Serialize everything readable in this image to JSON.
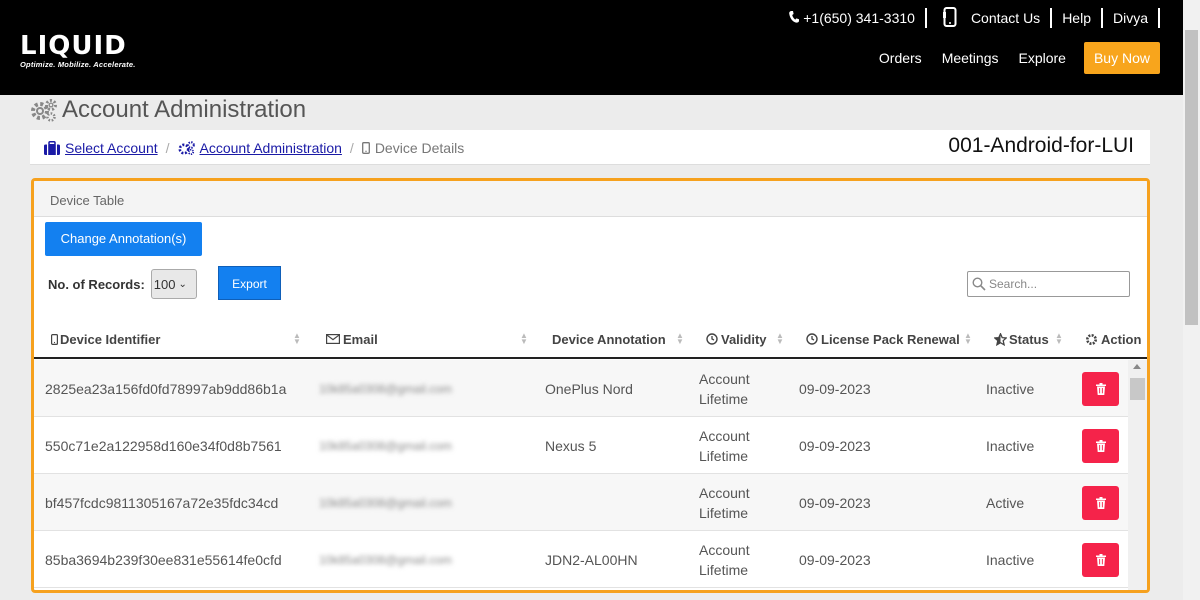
{
  "header": {
    "logo_text": "LIQUID",
    "logo_tagline": "Optimize. Mobilize. Accelerate.",
    "phone": "+1(650) 341-3310",
    "contact_label": "Contact Us",
    "help_label": "Help",
    "user_name": "Divya",
    "nav": [
      "Orders",
      "Meetings",
      "Explore"
    ],
    "buy_now_label": "Buy Now",
    "colors": {
      "background": "#000000",
      "buy_now": "#f8a51c"
    }
  },
  "page": {
    "title": "Account Administration"
  },
  "breadcrumb": {
    "items": [
      {
        "label": "Select Account",
        "icon": "briefcase-icon"
      },
      {
        "label": "Account Administration",
        "icon": "gears-icon"
      },
      {
        "label": "Device Details",
        "icon": "mobile-icon"
      }
    ],
    "account_name": "001-Android-for-LUI"
  },
  "panel": {
    "title": "Device Table",
    "change_annotation_label": "Change Annotation(s)",
    "records_label": "No. of Records:",
    "records_value": "100",
    "export_label": "Export",
    "search_placeholder": "Search...",
    "accent_color": "#f6a11e"
  },
  "table": {
    "columns": [
      {
        "label": "Device Identifier",
        "icon": "mobile-icon"
      },
      {
        "label": "Email",
        "icon": "envelope-icon"
      },
      {
        "label": "Device Annotation",
        "icon": ""
      },
      {
        "label": "Validity",
        "icon": "clock-icon"
      },
      {
        "label": "License Pack Renewal",
        "icon": "clock-icon"
      },
      {
        "label": "Status",
        "icon": "star-icon"
      },
      {
        "label": "Action",
        "icon": "gear-icon"
      }
    ],
    "rows": [
      {
        "device_id": "2825ea23a156fd0fd78997ab9dd86b1a",
        "email": "10k85a0308@gmail.com",
        "annotation": "OnePlus Nord",
        "validity_line1": "Account",
        "validity_line2": "Lifetime",
        "renewal": "09-09-2023",
        "status": "Inactive"
      },
      {
        "device_id": "550c71e2a122958d160e34f0d8b7561",
        "email": "10k85a0308@gmail.com",
        "annotation": "Nexus 5",
        "validity_line1": "Account",
        "validity_line2": "Lifetime",
        "renewal": "09-09-2023",
        "status": "Inactive"
      },
      {
        "device_id": "bf457fcdc9811305167a72e35fdc34cd",
        "email": "10k85a0308@gmail.com",
        "annotation": "",
        "validity_line1": "Account",
        "validity_line2": "Lifetime",
        "renewal": "09-09-2023",
        "status": "Active"
      },
      {
        "device_id": "85ba3694b239f30ee831e55614fe0cfd",
        "email": "10k85a0308@gmail.com",
        "annotation": "JDN2-AL00HN",
        "validity_line1": "Account",
        "validity_line2": "Lifetime",
        "renewal": "09-09-2023",
        "status": "Inactive"
      }
    ],
    "delete_color": "#f5234a"
  }
}
